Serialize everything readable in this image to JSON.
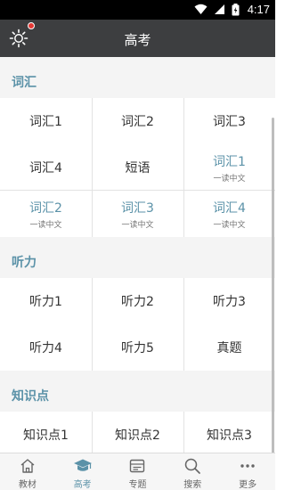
{
  "status_bar": {
    "time": "4:17"
  },
  "header": {
    "title": "高考"
  },
  "sections": [
    {
      "title": "词汇",
      "items": [
        {
          "label": "词汇1",
          "sub": "",
          "highlight": false
        },
        {
          "label": "词汇2",
          "sub": "",
          "highlight": false
        },
        {
          "label": "词汇3",
          "sub": "",
          "highlight": false
        },
        {
          "label": "词汇4",
          "sub": "",
          "highlight": false
        },
        {
          "label": "短语",
          "sub": "",
          "highlight": false
        },
        {
          "label": "词汇1",
          "sub": "一读中文",
          "highlight": true
        },
        {
          "label": "词汇2",
          "sub": "一读中文",
          "highlight": true
        },
        {
          "label": "词汇3",
          "sub": "一读中文",
          "highlight": true
        },
        {
          "label": "词汇4",
          "sub": "一读中文",
          "highlight": true
        }
      ]
    },
    {
      "title": "听力",
      "items": [
        {
          "label": "听力1",
          "sub": "",
          "highlight": false
        },
        {
          "label": "听力2",
          "sub": "",
          "highlight": false
        },
        {
          "label": "听力3",
          "sub": "",
          "highlight": false
        },
        {
          "label": "听力4",
          "sub": "",
          "highlight": false
        },
        {
          "label": "听力5",
          "sub": "",
          "highlight": false
        },
        {
          "label": "真题",
          "sub": "",
          "highlight": false
        }
      ]
    },
    {
      "title": "知识点",
      "items": [
        {
          "label": "知识点1",
          "sub": "",
          "highlight": false
        },
        {
          "label": "知识点2",
          "sub": "",
          "highlight": false
        },
        {
          "label": "知识点3",
          "sub": "",
          "highlight": false
        }
      ]
    }
  ],
  "tabs": [
    {
      "label": "教材",
      "icon": "home-icon",
      "active": false
    },
    {
      "label": "高考",
      "icon": "graduation-cap-icon",
      "active": true
    },
    {
      "label": "专题",
      "icon": "topic-card-icon",
      "active": false
    },
    {
      "label": "搜索",
      "icon": "search-icon",
      "active": false
    },
    {
      "label": "更多",
      "icon": "more-icon",
      "active": false
    }
  ],
  "colors": {
    "accent": "#5b92a8",
    "header_bg": "#3d3e40",
    "status_bg": "#000000",
    "badge": "#e53935"
  }
}
